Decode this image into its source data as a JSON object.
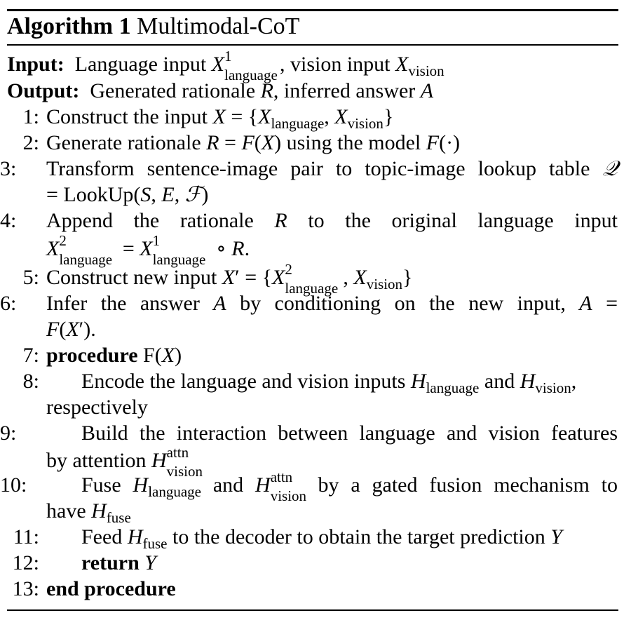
{
  "title": {
    "label": "Algorithm 1",
    "name": "Multimodal-CoT"
  },
  "input": {
    "label": "Input:",
    "text": "Language input X1language, vision input Xvision"
  },
  "output": {
    "label": "Output:",
    "text": "Generated rationale R, inferred answer A"
  },
  "steps": [
    {
      "num": "1:",
      "text": "Construct the input X = {Xlanguage, Xvision}"
    },
    {
      "num": "2:",
      "text": "Generate rationale R = F(X) using the model F(·)"
    },
    {
      "num": "3:",
      "text": "Transform sentence-image pair to topic-image lookup table Q = LookUp(S, E, F)"
    },
    {
      "num": "4:",
      "text": "Append the rationale R to the original language input X2language = X1language ∘ R."
    },
    {
      "num": "5:",
      "text": "Construct new input X′ = {X2language, Xvision}"
    },
    {
      "num": "6:",
      "text": "Infer the answer A by conditioning on the new input, A = F(X′)."
    },
    {
      "num": "7:",
      "text": "procedure F(X)"
    },
    {
      "num": "8:",
      "text": "Encode the language and vision inputs Hlanguage and Hvision, respectively"
    },
    {
      "num": "9:",
      "text": "Build the interaction between language and vision features by attention Hattnvision"
    },
    {
      "num": "10:",
      "text": "Fuse Hlanguage and Hattnvision by a gated fusion mechanism to have Hfuse"
    },
    {
      "num": "11:",
      "text": "Feed Hfuse to the decoder to obtain the target prediction Y"
    },
    {
      "num": "12:",
      "text": "return Y"
    },
    {
      "num": "13:",
      "text": "end procedure"
    }
  ]
}
